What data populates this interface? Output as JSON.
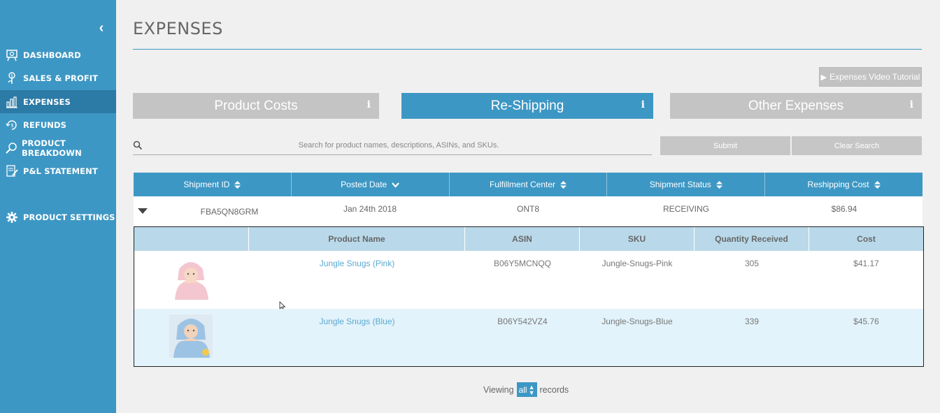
{
  "sidebar": {
    "items": [
      {
        "label": "DASHBOARD",
        "icon": "dashboard-icon"
      },
      {
        "label": "SALES & PROFIT",
        "icon": "money-tree-icon"
      },
      {
        "label": "EXPENSES",
        "icon": "bar-chart-icon",
        "active": true
      },
      {
        "label": "REFUNDS",
        "icon": "refund-icon"
      },
      {
        "label": "PRODUCT BREAKDOWN",
        "icon": "magnifier-icon"
      },
      {
        "label": "P&L STATEMENT",
        "icon": "document-edit-icon"
      },
      {
        "label": "PRODUCT SETTINGS",
        "icon": "gear-icon"
      }
    ]
  },
  "page": {
    "title": "EXPENSES",
    "tutorial_label": "Expenses Video Tutorial"
  },
  "tabs": [
    {
      "label": "Product Costs",
      "info": "i"
    },
    {
      "label": "Re-Shipping",
      "info": "i",
      "active": true
    },
    {
      "label": "Other Expenses",
      "info": "i"
    }
  ],
  "search": {
    "placeholder": "Search for product names, descriptions, ASINs, and SKUs.",
    "submit_label": "Submit",
    "clear_label": "Clear Search"
  },
  "shipments_table": {
    "headers": [
      "Shipment ID",
      "Posted Date",
      "Fulfillment Center",
      "Shipment Status",
      "Reshipping Cost"
    ],
    "rows": [
      {
        "shipment_id": "FBA5QN8GRM",
        "posted_date": "Jan 24th 2018",
        "fulfillment_center": "ONT8",
        "status": "RECEIVING",
        "cost": "$86.94"
      }
    ]
  },
  "products_table": {
    "headers": [
      "",
      "Product Name",
      "ASIN",
      "SKU",
      "Quantity Received",
      "Cost"
    ],
    "rows": [
      {
        "name": "Jungle Snugs (Pink)",
        "asin": "B06Y5MCNQQ",
        "sku": "Jungle-Snugs-Pink",
        "qty": "305",
        "cost": "$41.17"
      },
      {
        "name": "Jungle Snugs (Blue)",
        "asin": "B06Y542VZ4",
        "sku": "Jungle-Snugs-Blue",
        "qty": "339",
        "cost": "$45.76"
      }
    ]
  },
  "footer": {
    "viewing_prefix": "Viewing",
    "viewing_value": "all",
    "viewing_suffix": "records"
  },
  "colors": {
    "accent": "#3d97c4",
    "inactive_button": "#c4c4c4",
    "subheader": "#b9d9ea",
    "highlight_row": "#e3f3fb"
  }
}
